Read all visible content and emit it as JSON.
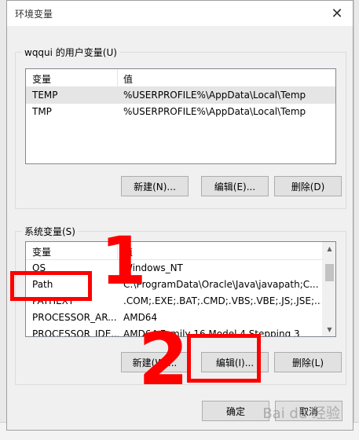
{
  "window": {
    "title": "环境变量",
    "close_glyph": "✕"
  },
  "user_vars": {
    "group_label": "wqqui 的用户变量(U)",
    "columns": [
      "变量",
      "值"
    ],
    "rows": [
      {
        "name": "TEMP",
        "value": "%USERPROFILE%\\AppData\\Local\\Temp"
      },
      {
        "name": "TMP",
        "value": "%USERPROFILE%\\AppData\\Local\\Temp"
      }
    ],
    "new_label": "新建(N)...",
    "edit_label": "编辑(E)...",
    "delete_label": "删除(D)"
  },
  "system_vars": {
    "group_label": "系统变量(S)",
    "columns": [
      "变量",
      "值"
    ],
    "rows": [
      {
        "name": "OS",
        "value": "Windows_NT"
      },
      {
        "name": "Path",
        "value": "C:\\ProgramData\\Oracle\\Java\\javapath;C..."
      },
      {
        "name": "PATHEXT",
        "value": ".COM;.EXE;.BAT;.CMD;.VBS;.VBE;.JS;.JSE;..."
      },
      {
        "name": "PROCESSOR_AR...",
        "value": "AMD64"
      },
      {
        "name": "PROCESSOR_IDE...",
        "value": "AMD64 Family 16 Model 4 Stepping 3"
      }
    ],
    "new_label": "新建(W)...",
    "edit_label": "编辑(I)...",
    "delete_label": "删除(L)"
  },
  "footer": {
    "ok_label": "确定",
    "cancel_label": "取消"
  },
  "annotations": {
    "step1": "1",
    "step2": "2"
  },
  "watermark": "Bai du 经验",
  "colors": {
    "annotation": "#ff0000",
    "selection": "#e5e5e5"
  }
}
